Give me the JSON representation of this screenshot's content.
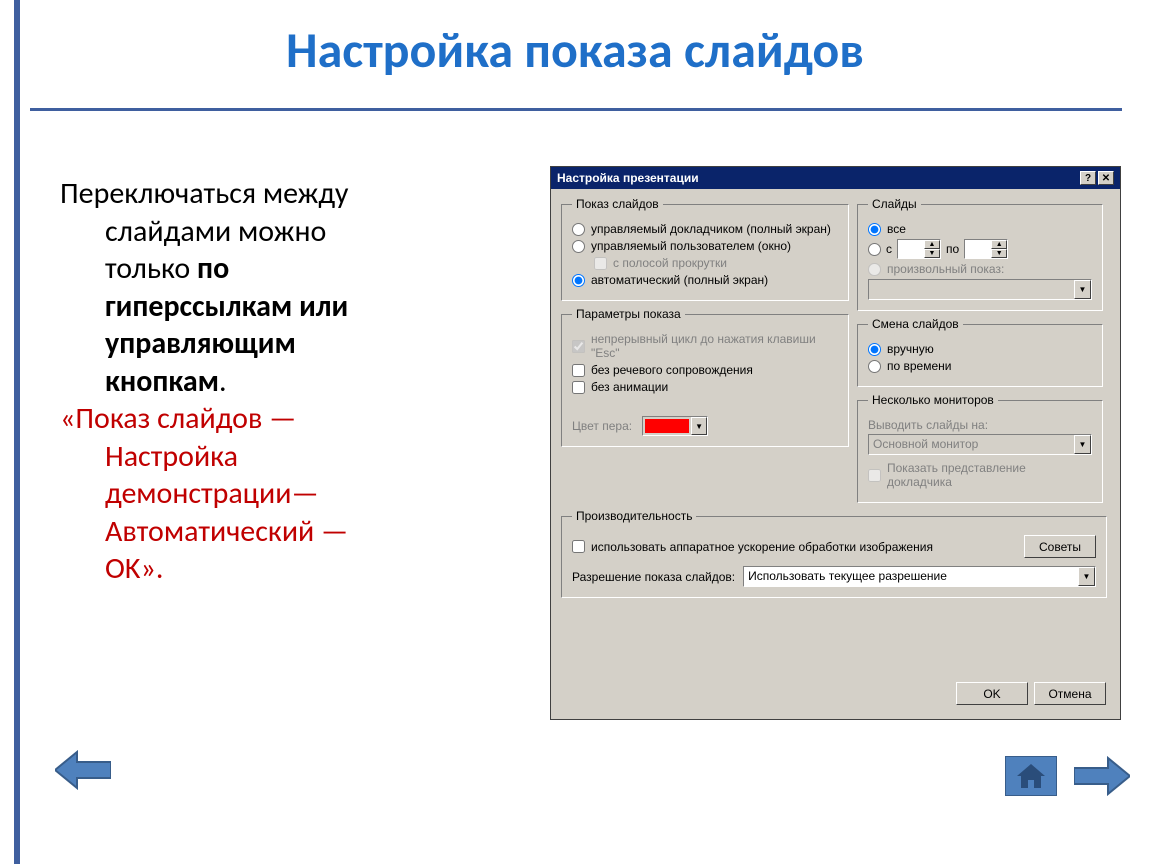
{
  "slide": {
    "title": "Настройка показа слайдов",
    "para1_line1": "Переключаться между",
    "para1_line2": "слайдами можно",
    "para1_line3_a": "только ",
    "para1_line3_b": "по",
    "para1_line4": "гиперссылкам или",
    "para1_line5": "управляющим",
    "para1_line6": "кнопкам",
    "para1_dot": ".",
    "para2_line1": "«Показ слайдов —",
    "para2_line2": "Настройка",
    "para2_line3": "демонстрации—",
    "para2_line4": "Автоматический —",
    "para2_line5": "OK»."
  },
  "dialog": {
    "title": "Настройка презентации",
    "fs_show": {
      "legend": "Показ слайдов",
      "opt_speaker": "управляемый докладчиком (полный экран)",
      "opt_user": "управляемый пользователем (окно)",
      "opt_scrollbar": "с полосой прокрутки",
      "opt_auto": "автоматический (полный экран)"
    },
    "fs_params": {
      "legend": "Параметры показа",
      "chk_loop": "непрерывный цикл до нажатия клавиши \"Esc\"",
      "chk_noaudio": "без речевого сопровождения",
      "chk_noanim": "без анимации",
      "pen_label": "Цвет пера:",
      "pen_color": "#ff0000"
    },
    "fs_slides": {
      "legend": "Слайды",
      "opt_all": "все",
      "opt_from": "с",
      "range_to": "по",
      "opt_custom": "произвольный показ:"
    },
    "fs_change": {
      "legend": "Смена слайдов",
      "opt_manual": "вручную",
      "opt_time": "по времени"
    },
    "fs_monitors": {
      "legend": "Несколько мониторов",
      "label_output": "Выводить слайды на:",
      "combo_value": "Основной монитор",
      "chk_presenter": "Показать представление докладчика"
    },
    "fs_perf": {
      "legend": "Производительность",
      "chk_hw": "использовать аппаратное ускорение обработки изображения",
      "btn_tips": "Советы",
      "res_label": "Разрешение показа слайдов:",
      "res_value": "Использовать текущее разрешение"
    },
    "btn_ok": "OK",
    "btn_cancel": "Отмена"
  }
}
